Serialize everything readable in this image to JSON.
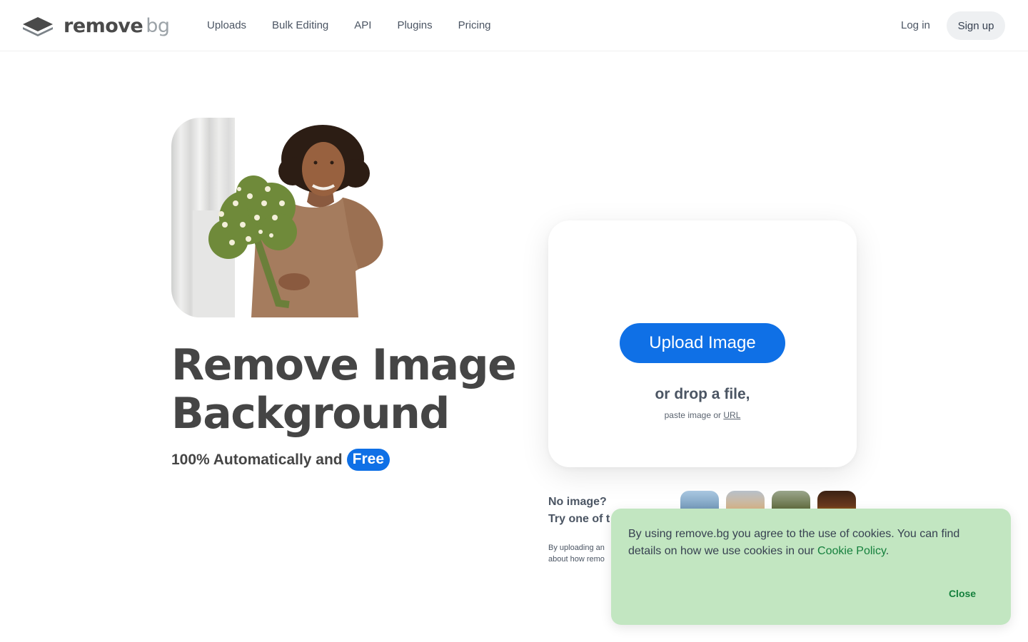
{
  "header": {
    "logo": {
      "word1": "remove",
      "word2": "bg",
      "icon": "stacked-layers-logo-icon"
    },
    "nav": [
      {
        "label": "Uploads"
      },
      {
        "label": "Bulk Editing"
      },
      {
        "label": "API"
      },
      {
        "label": "Plugins"
      },
      {
        "label": "Pricing"
      }
    ],
    "login_label": "Log in",
    "signup_label": "Sign up"
  },
  "hero": {
    "title_line1": "Remove Image",
    "title_line2": "Background",
    "subtitle": "100% Automatically and",
    "badge": "Free"
  },
  "upload": {
    "button_label": "Upload Image",
    "drop_text": "or drop a file,",
    "paste_text": "paste image or",
    "url_label": "URL"
  },
  "samples": {
    "line1": "No image?",
    "line2": "Try one of t",
    "disclaimer_line1": "By uploading an",
    "disclaimer_line2": "about how remo"
  },
  "cookie": {
    "text": "By using remove.bg you agree to the use of cookies. You can find details on how we use cookies in our",
    "link_label": "Cookie Policy",
    "suffix": ".",
    "close_label": "Close",
    "accent_color": "#15803d",
    "background_color": "#c2e6c1"
  },
  "colors": {
    "primary": "#0f70e6",
    "text": "#454545"
  }
}
